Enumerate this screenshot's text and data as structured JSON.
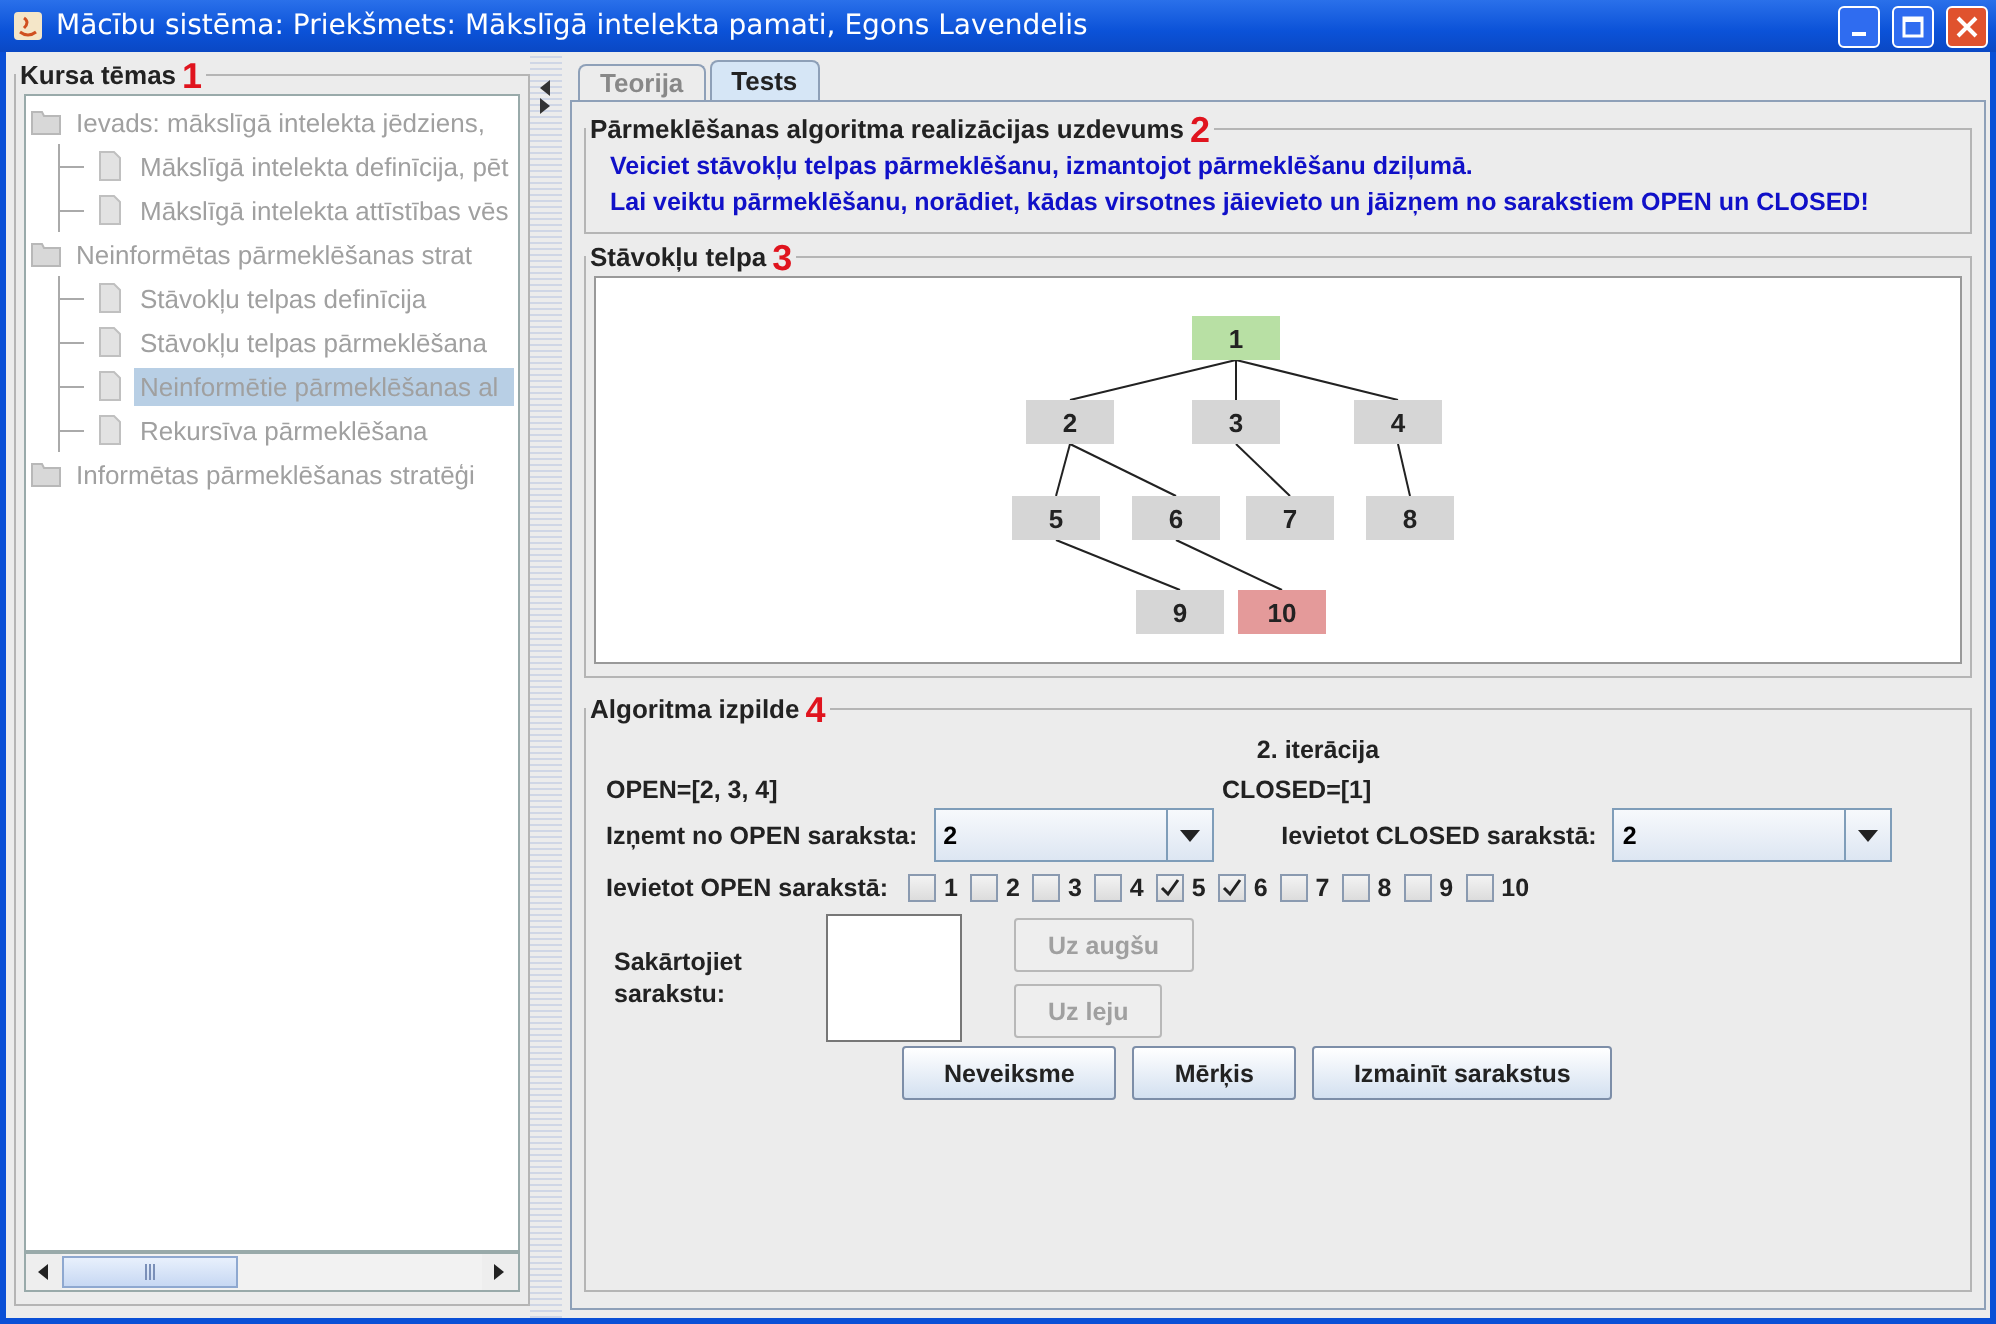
{
  "window": {
    "title": "Mācību sistēma: Priekšmets: Mākslīgā intelekta pamati, Egons Lavendelis"
  },
  "sidebar": {
    "title": "Kursa tēmas",
    "marker": "1",
    "items": [
      {
        "label": "Ievads: mākslīgā intelekta jēdziens,",
        "kind": "folder",
        "selected": false,
        "children": [
          {
            "label": "Mākslīgā intelekta definīcija, pēt",
            "selected": false
          },
          {
            "label": "Mākslīgā intelekta attīstības vēs",
            "selected": false
          }
        ]
      },
      {
        "label": "Neinformētas pārmeklēšanas strat",
        "kind": "folder",
        "selected": false,
        "children": [
          {
            "label": "Stāvokļu telpas definīcija",
            "selected": false
          },
          {
            "label": "Stāvokļu telpas pārmeklēšana",
            "selected": false
          },
          {
            "label": "Neinformētie pārmeklēšanas al",
            "selected": true
          },
          {
            "label": "Rekursīva pārmeklēšana",
            "selected": false
          }
        ]
      },
      {
        "label": "Informētas pārmeklēšanas stratēģi",
        "kind": "folder",
        "selected": false
      }
    ]
  },
  "tabs": [
    {
      "label": "Teorija",
      "selected": false
    },
    {
      "label": "Tests",
      "selected": true
    }
  ],
  "task": {
    "title": "Pārmeklēšanas algoritma realizācijas uzdevums",
    "marker": "2",
    "lines": [
      "Veiciet stāvokļu telpas pārmeklēšanu, izmantojot  pārmeklēšanu dziļumā.",
      "Lai veiktu pārmeklēšanu, norādiet, kādas virsotnes jāievieto un jāizņem no sarakstiem OPEN un CLOSED!"
    ]
  },
  "state_space": {
    "title": "Stāvokļu telpa",
    "marker": "3",
    "tree": {
      "label": "1",
      "color": "#b8e0a4",
      "children": [
        {
          "label": "2",
          "color": "#d6d6d6",
          "children": [
            {
              "label": "5",
              "color": "#d6d6d6",
              "children": [
                {
                  "label": "9",
                  "color": "#d6d6d6"
                }
              ]
            },
            {
              "label": "6",
              "color": "#d6d6d6",
              "children": [
                {
                  "label": "10",
                  "color": "#e49a9a"
                }
              ]
            }
          ]
        },
        {
          "label": "3",
          "color": "#d6d6d6",
          "children": [
            {
              "label": "7",
              "color": "#d6d6d6"
            }
          ]
        },
        {
          "label": "4",
          "color": "#d6d6d6",
          "children": [
            {
              "label": "8",
              "color": "#d6d6d6"
            }
          ]
        }
      ]
    }
  },
  "execution": {
    "title": "Algoritma izpilde",
    "marker": "4",
    "iteration": "2. iterācija",
    "open": "OPEN=[2, 3, 4]",
    "closed": "CLOSED=[1]",
    "remove_label": "Izņemt no OPEN saraksta:",
    "remove_value": "2",
    "insert_closed_label": "Ievietot CLOSED sarakstā:",
    "insert_closed_value": "2",
    "insert_open_label": "Ievietot OPEN sarakstā:",
    "checkboxes": [
      {
        "label": "1",
        "checked": false
      },
      {
        "label": "2",
        "checked": false
      },
      {
        "label": "3",
        "checked": false
      },
      {
        "label": "4",
        "checked": false
      },
      {
        "label": "5",
        "checked": true
      },
      {
        "label": "6",
        "checked": true
      },
      {
        "label": "7",
        "checked": false
      },
      {
        "label": "8",
        "checked": false
      },
      {
        "label": "9",
        "checked": false
      },
      {
        "label": "10",
        "checked": false
      }
    ],
    "sort_label": "Sakārtojiet sarakstu:",
    "move_buttons": [
      {
        "label": "Uz augšu",
        "disabled": true
      },
      {
        "label": "Uz leju",
        "disabled": true
      }
    ],
    "buttons": [
      "Neveiksme",
      "Mērķis",
      "Izmainīt sarakstus"
    ]
  }
}
